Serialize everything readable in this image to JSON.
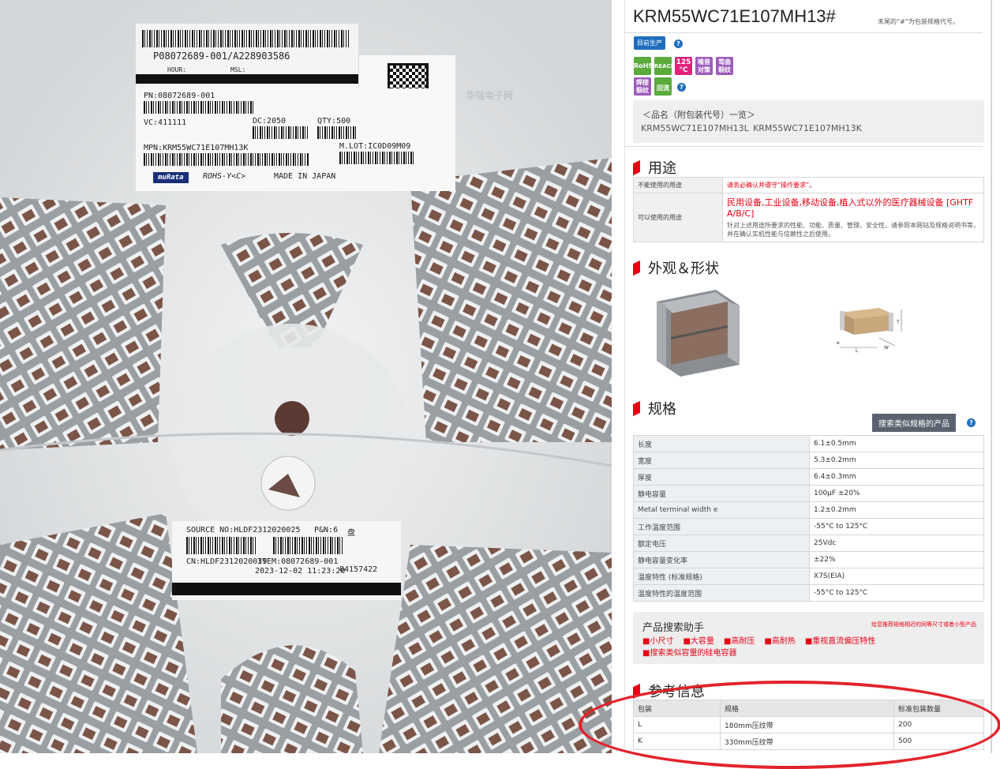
{
  "product": {
    "part_number": "KRM55WC71E107MH13#",
    "note": "末尾的“#”为包装规格代号。",
    "status_badge": "目前生产",
    "icons": [
      {
        "label": "RoHS",
        "color": "#5aaa3c",
        "icon": "rohs-icon"
      },
      {
        "label": "REACH",
        "color": "#5aaa3c",
        "icon": "reach-icon"
      },
      {
        "label": "125 °C max",
        "color": "#e4207a",
        "icon": "temperature-icon"
      },
      {
        "label": "噪音对策",
        "color": "#9d5cbb",
        "icon": "noise-icon"
      },
      {
        "label": "弯曲裂纹",
        "color": "#9d5cbb",
        "icon": "bend-crack-icon"
      },
      {
        "label": "焊接裂纹",
        "color": "#9d5cbb",
        "icon": "solder-crack-icon"
      },
      {
        "label": "回流",
        "color": "#5aaa3c",
        "icon": "reflow-icon"
      }
    ],
    "variants_title": "＜品名（附包装代号）一览＞",
    "variants": [
      "KRM55WC71E107MH13L",
      "KRM55WC71E107MH13K"
    ]
  },
  "usage": {
    "title": "用途",
    "rows": [
      {
        "key": "不能使用的用途",
        "value": "请务必确认并遵守“操作要求”。",
        "red": true
      },
      {
        "key": "可以使用的用途",
        "value": "民用设备,工业设备,移动设备,植入式以外的医疗器械设备 [GHTF A/B/C]",
        "note": "针对上述用途所要求的性能、功能、质量、管理、安全性，请参照本网站及规格说明书等，并在确认实机性能与信赖性之后使用。",
        "red": true
      }
    ]
  },
  "appearance": {
    "title": "外观＆形状"
  },
  "specs": {
    "title": "规格",
    "search_button": "搜索类似规格的产品",
    "rows": [
      {
        "key": "长度",
        "value": "6.1±0.5mm"
      },
      {
        "key": "宽度",
        "value": "5.3±0.2mm"
      },
      {
        "key": "厚度",
        "value": "6.4±0.3mm"
      },
      {
        "key": "静电容量",
        "value": "100μF ±20%"
      },
      {
        "key": "Metal terminal width e",
        "value": "1.2±0.2mm"
      },
      {
        "key": "工作温度范围",
        "value": "-55°C to 125°C"
      },
      {
        "key": "额定电压",
        "value": "25Vdc"
      },
      {
        "key": "静电容量变化率",
        "value": "±22%"
      },
      {
        "key": "温度特性 (标准规格)",
        "value": "X7S(EIA)"
      },
      {
        "key": "温度特性的温度范围",
        "value": "-55°C to 125°C"
      }
    ]
  },
  "assist": {
    "title": "产品搜索助手",
    "note": "给您推荐规格相近的同等尺寸或者小型产品",
    "links": [
      "■小尺寸",
      "■大容量",
      "■高耐压",
      "■高耐热",
      "■重视直流偏压特性",
      "■搜索类似容量的硅电容器"
    ]
  },
  "reference": {
    "title": "参考信息",
    "headers": [
      "包装",
      "规格",
      "标准包装数量"
    ],
    "rows": [
      [
        "L",
        "180mm压纹带",
        "200"
      ],
      [
        "K",
        "330mm压纹带",
        "500"
      ]
    ]
  },
  "reel_label": {
    "top_code": "P08072689-001/A228903586",
    "hour": "HOUR:",
    "msl": "MSL:",
    "pn": "PN:08072689-001",
    "vc": "VC:411111",
    "dc": "DC:2050",
    "qty": "QTY:500",
    "mpn": "MPN:KRM55WC71E107MH13K",
    "mlot": "M.LOT:IC0D09M09",
    "brand": "muRata",
    "rohs": "ROHS-Y<C>",
    "made": "MADE IN JAPAN"
  },
  "source_label": {
    "source": "SOURCE NO:HLDF2312020025",
    "pn": "P&N:6",
    "unit": "盘",
    "cn": "CN:HLDF2312020039",
    "item": "ITEM:08072689-001",
    "date": "2023-12-02 11:23:20",
    "code": "84157422"
  },
  "watermark": "华强电子网"
}
